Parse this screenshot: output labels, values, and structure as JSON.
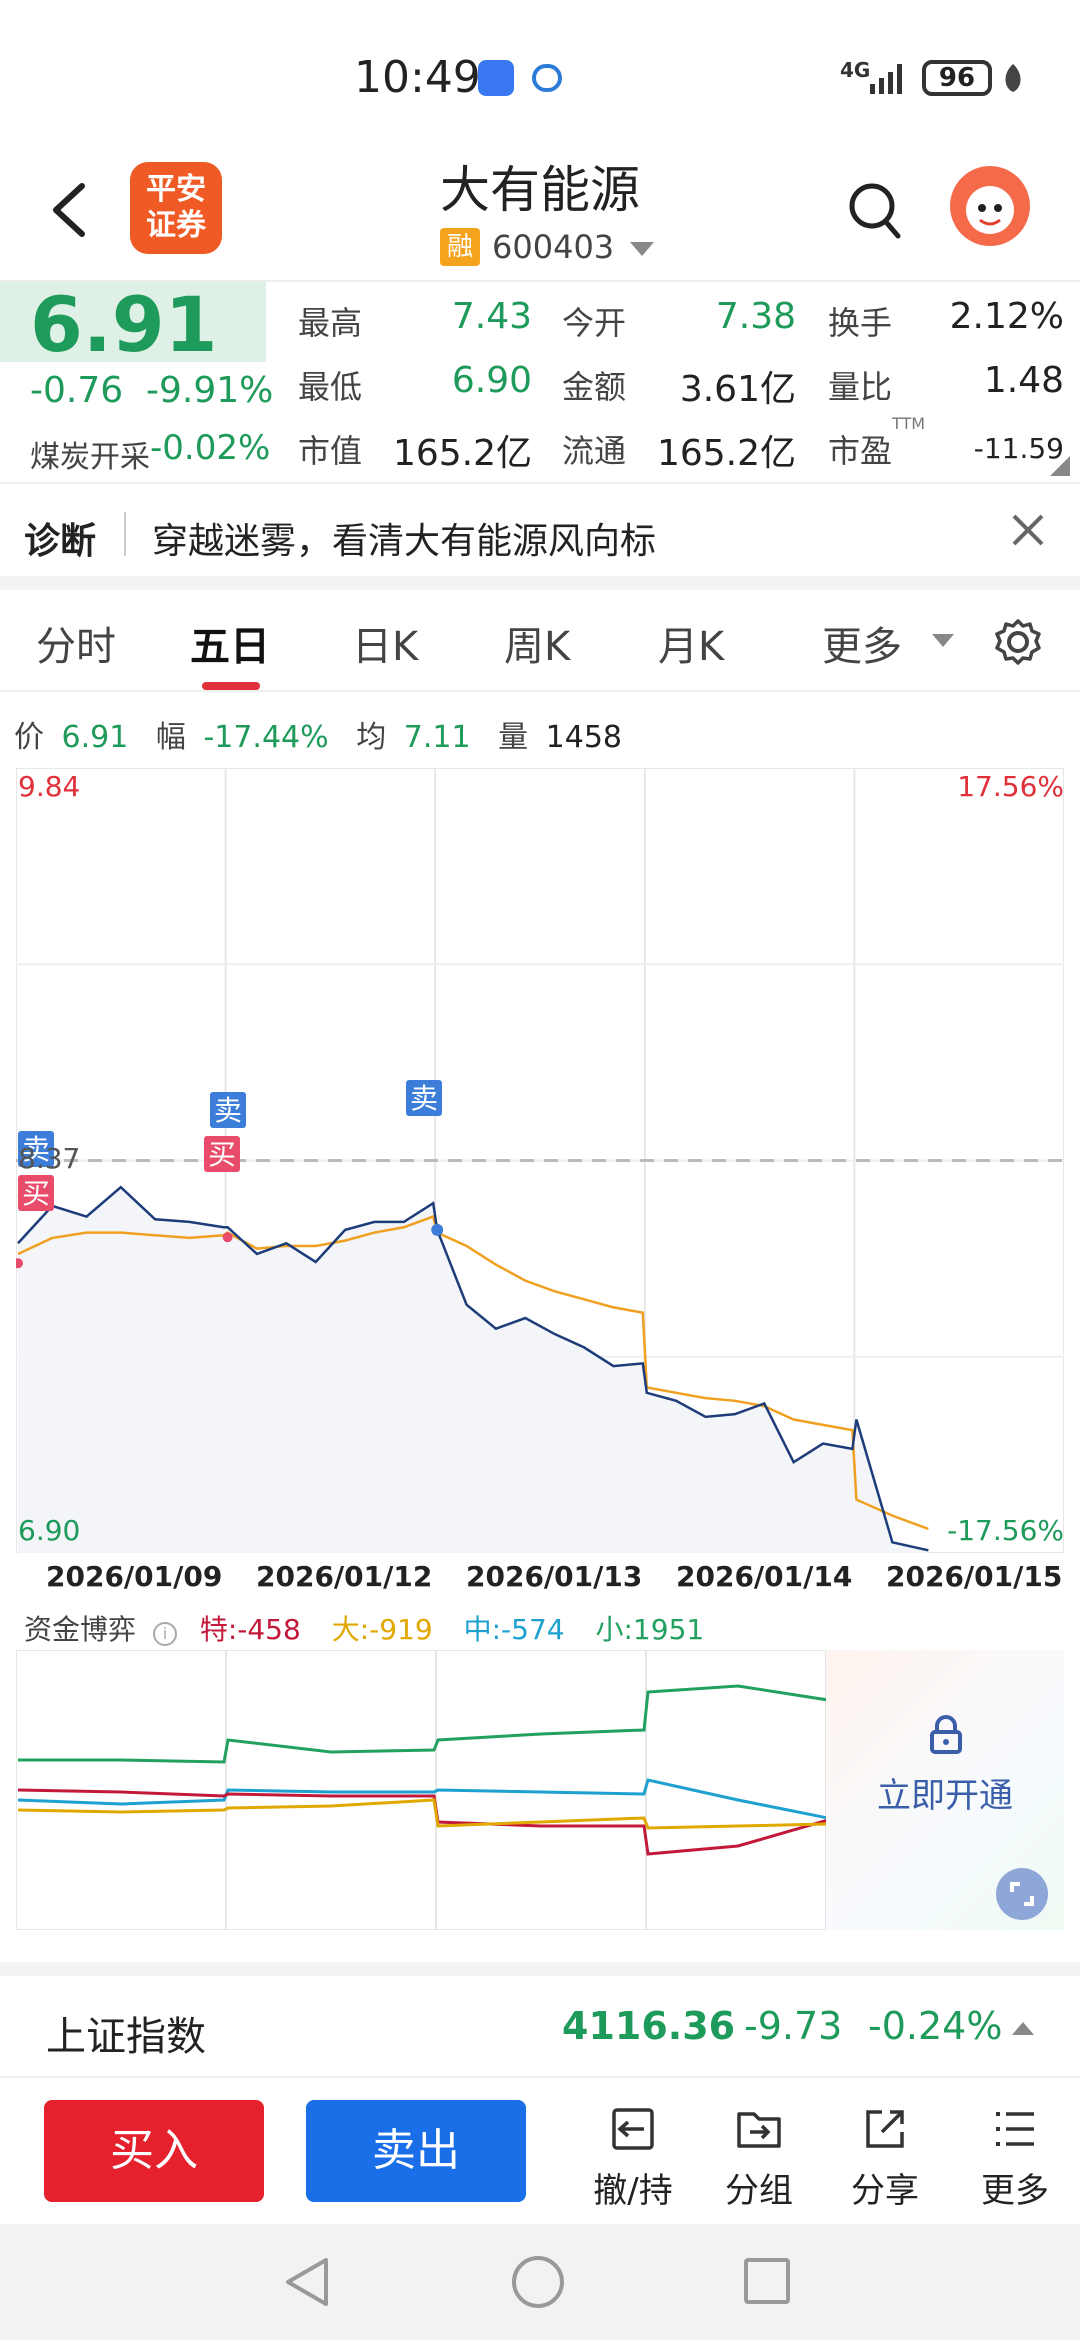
{
  "status_bar": {
    "time": "10:49",
    "network": "4G",
    "battery": "96"
  },
  "header": {
    "back_label": "back",
    "broker_logo": "平安\n证券",
    "title": "大有能源",
    "margin_badge": "融",
    "code": "600403"
  },
  "quote": {
    "price": "6.91",
    "change": "-0.76",
    "change_pct": "-9.91%",
    "sector_name": "煤炭开采",
    "sector_change": "-0.02%",
    "stats": [
      {
        "label": "最高",
        "value": "7.43",
        "color": "#1e9a5a"
      },
      {
        "label": "今开",
        "value": "7.38",
        "color": "#1e9a5a"
      },
      {
        "label": "换手",
        "value": "2.12%",
        "color": "#222222"
      },
      {
        "label": "最低",
        "value": "6.90",
        "color": "#1e9a5a"
      },
      {
        "label": "金额",
        "value": "3.61亿",
        "color": "#222222"
      },
      {
        "label": "量比",
        "value": "1.48",
        "color": "#222222"
      },
      {
        "label": "市值",
        "value": "165.2亿",
        "color": "#222222"
      },
      {
        "label": "流通",
        "value": "165.2亿",
        "color": "#222222"
      },
      {
        "label": "市盈",
        "value": "-11.59",
        "color": "#222222"
      }
    ],
    "pe_superscript": "TTM"
  },
  "diagnosis": {
    "label": "诊断",
    "text": "穿越迷雾，看清大有能源风向标"
  },
  "tabs": [
    {
      "label": "分时",
      "active": false
    },
    {
      "label": "五日",
      "active": true
    },
    {
      "label": "日K",
      "active": false
    },
    {
      "label": "周K",
      "active": false
    },
    {
      "label": "月K",
      "active": false
    },
    {
      "label": "更多",
      "active": false
    }
  ],
  "info_row": {
    "price_label": "价",
    "price": "6.91",
    "range_label": "幅",
    "range": "-17.44%",
    "avg_label": "均",
    "avg": "7.11",
    "vol_label": "量",
    "vol": "1458"
  },
  "chart_data": {
    "type": "line",
    "x": [
      "2026/01/09",
      "2026/01/12",
      "2026/01/13",
      "2026/01/14",
      "2026/01/15"
    ],
    "y_top": "9.84",
    "y_bottom": "6.90",
    "y_top_pct": "17.56%",
    "y_bottom_pct": "-17.56%",
    "prev_close": "8.37",
    "ylim": [
      6.9,
      9.84
    ],
    "markers": [
      {
        "label": "卖",
        "day": 0
      },
      {
        "label": "买",
        "day": 0
      },
      {
        "label": "卖",
        "day": 1
      },
      {
        "label": "买",
        "day": 1
      },
      {
        "label": "卖",
        "day": 2
      }
    ],
    "series": [
      {
        "name": "price",
        "color": "#1d3c7a",
        "values": [
          8.06,
          8.2,
          8.16,
          8.27,
          8.15,
          8.14,
          8.12,
          8.12,
          8.02,
          8.06,
          7.99,
          8.11,
          8.14,
          8.14,
          8.21,
          8.11,
          7.83,
          7.74,
          7.78,
          7.72,
          7.67,
          7.6,
          7.61,
          7.5,
          7.47,
          7.41,
          7.42,
          7.46,
          7.24,
          7.31,
          7.29,
          7.4,
          6.94,
          6.91
        ]
      },
      {
        "name": "avg",
        "color": "#f0a020",
        "values": [
          8.02,
          8.08,
          8.1,
          8.1,
          8.09,
          8.08,
          8.09,
          8.1,
          8.04,
          8.05,
          8.05,
          8.07,
          8.1,
          8.12,
          8.16,
          8.1,
          8.05,
          7.98,
          7.92,
          7.88,
          7.85,
          7.82,
          7.8,
          7.52,
          7.5,
          7.48,
          7.47,
          7.45,
          7.4,
          7.38,
          7.36,
          7.1,
          7.04,
          6.99
        ]
      }
    ]
  },
  "fund": {
    "label": "资金博弈",
    "special": "特:-458",
    "large": "大:-919",
    "medium": "中:-574",
    "small": "小:1951",
    "unlock_text": "立即开通",
    "colors": {
      "special": "#c2183a",
      "large": "#e0a800",
      "medium": "#1ea0d0",
      "small": "#22a060"
    }
  },
  "index": {
    "name": "上证指数",
    "value": "4116.36",
    "change": "-9.73",
    "change_pct": "-0.24%"
  },
  "bottom_bar": {
    "buy": "买入",
    "sell": "卖出",
    "tools": [
      "撤/持",
      "分组",
      "分享",
      "更多"
    ]
  },
  "colors": {
    "up": "#e0303a",
    "down": "#1e9a5a",
    "buy": "#e5212d",
    "sell": "#1a6fe8"
  }
}
